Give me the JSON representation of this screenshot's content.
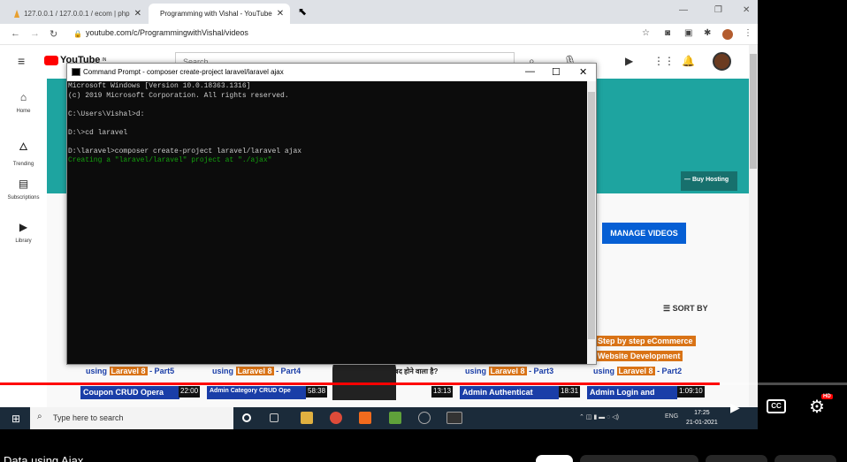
{
  "browser": {
    "tabs": [
      {
        "title": "127.0.0.1 / 127.0.0.1 / ecom | php",
        "close": "✕"
      },
      {
        "title": "Programming with Vishal - YouTube",
        "close": "✕"
      }
    ],
    "window_controls": [
      "—",
      "❐",
      "✕"
    ],
    "url": "youtube.com/c/ProgrammingwithVishal/videos"
  },
  "youtube": {
    "logo": "YouTube",
    "region": "IN",
    "search_placeholder": "Search",
    "sidebar": [
      {
        "label": "Home",
        "icon": "home-icon",
        "glyph": "⌂"
      },
      {
        "label": "Trending",
        "icon": "fire-icon",
        "glyph": "🜂"
      },
      {
        "label": "Subscriptions",
        "icon": "subscriptions-icon",
        "glyph": "▤"
      },
      {
        "label": "Library",
        "icon": "library-icon",
        "glyph": "▶"
      }
    ],
    "buy_hosting": "Buy Hosting",
    "manage_videos": "MANAGE VIDEOS",
    "sort_by": "SORT BY",
    "videos": [
      {
        "top": "using",
        "hl": "Laravel 8",
        "part": "- Part5",
        "caption": "Coupon CRUD Opera",
        "duration": "22:00"
      },
      {
        "top": "using",
        "hl": "Laravel 8",
        "part": "- Part4",
        "caption": "Admin Category CRUD Ope",
        "duration": "58:38"
      },
      {
        "top": "बद होने वाला है?",
        "caption": "",
        "duration": "13:13"
      },
      {
        "top": "using",
        "hl": "Laravel 8",
        "part": "- Part3",
        "caption": "Admin Authenticat",
        "duration": "18:31"
      },
      {
        "top": "using",
        "hl": "Laravel 8",
        "part": "- Part2",
        "caption": "Admin Login and",
        "duration": "1:09:10"
      }
    ],
    "promo_lines": [
      "Step by step eCommerce",
      "Website Development"
    ]
  },
  "cmd": {
    "title": "Command Prompt - composer  create-project laravel/laravel ajax",
    "lines": [
      "Microsoft Windows [Version 10.0.18363.1316]",
      "(c) 2019 Microsoft Corporation. All rights reserved.",
      "",
      "C:\\Users\\Vishal>d:",
      "",
      "D:\\>cd laravel",
      "",
      "D:\\laravel>composer create-project laravel/laravel ajax"
    ],
    "status_line": "Creating a \"laravel/laravel\" project at \"./ajax\""
  },
  "taskbar": {
    "search_placeholder": "Type here to search",
    "lang": "ENG",
    "time": "17:25",
    "date": "21-01-2021"
  },
  "player": {
    "progress": 0.85,
    "cc": "CC",
    "hd": "HD"
  },
  "video_title": "Data using Ajax"
}
